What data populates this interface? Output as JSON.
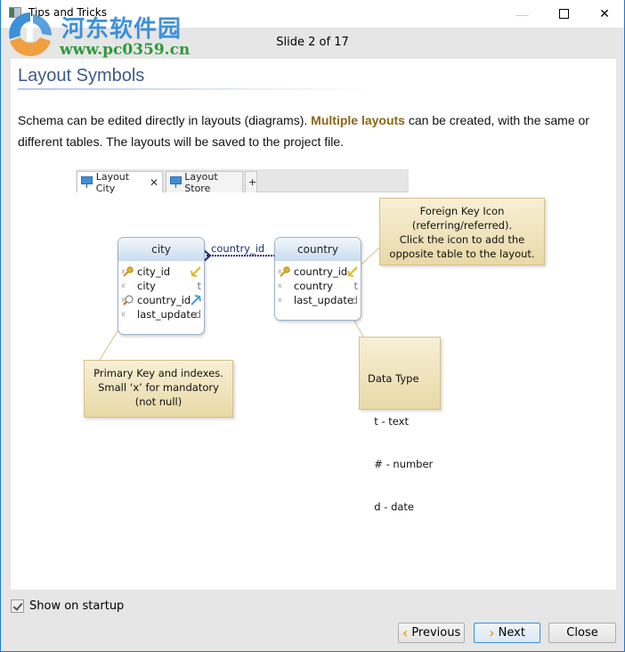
{
  "window": {
    "title": "Tips and Tricks",
    "controls": {
      "minimize": "—",
      "close": "✕"
    }
  },
  "watermark": {
    "chinese_text": "河东软件园",
    "url": "www.pc0359.cn"
  },
  "slide_counter": "Slide 2 of 17",
  "content": {
    "heading": "Layout Symbols",
    "paragraph_before": "Schema can be edited directly in layouts (diagrams). ",
    "paragraph_highlight": "Multiple layouts",
    "paragraph_after": " can be created, with the same or different tables. The layouts will be saved to the project file.",
    "highlight_color": "#8a6614"
  },
  "diagram": {
    "tabs": [
      {
        "label": "Layout City",
        "icon": "monitor-icon",
        "closable": true,
        "close_glyph": "✕"
      },
      {
        "label": "Layout Store",
        "icon": "monitor-icon",
        "closable": false
      },
      {
        "label": "+"
      }
    ],
    "entities": [
      {
        "name": "city",
        "columns": [
          {
            "name": "city_id",
            "type": "",
            "mandatory": true,
            "icon": "primary-key-icon",
            "fk_arrow": "referred"
          },
          {
            "name": "city",
            "type": "t",
            "mandatory": true
          },
          {
            "name": "country_id",
            "type": "",
            "mandatory": true,
            "icon": "index-icon",
            "fk_arrow": "referring"
          },
          {
            "name": "last_update",
            "type": "d",
            "mandatory": true
          }
        ]
      },
      {
        "name": "country",
        "columns": [
          {
            "name": "country_id",
            "type": "",
            "mandatory": true,
            "icon": "primary-key-icon",
            "fk_arrow": "referred"
          },
          {
            "name": "country",
            "type": "t",
            "mandatory": true
          },
          {
            "name": "last_update",
            "type": "d",
            "mandatory": true
          }
        ]
      }
    ],
    "relationship_label": "country_id",
    "mandatory_mark": "x",
    "notes": {
      "foreign_key": [
        "Foreign Key Icon",
        "(referring/referred).",
        "Click the icon to add the",
        "opposite table to the layout."
      ],
      "primary_key": [
        "Primary Key and indexes.",
        "Small ‘x’ for mandatory",
        "(not null)"
      ],
      "data_type": [
        "Data Type",
        "  t - text",
        "  # - number",
        "  d - date"
      ]
    }
  },
  "footer": {
    "show_on_startup_label": "Show on startup",
    "show_on_startup_checked": true,
    "buttons": {
      "previous": "Previous",
      "next": "Next",
      "close": "Close"
    }
  }
}
